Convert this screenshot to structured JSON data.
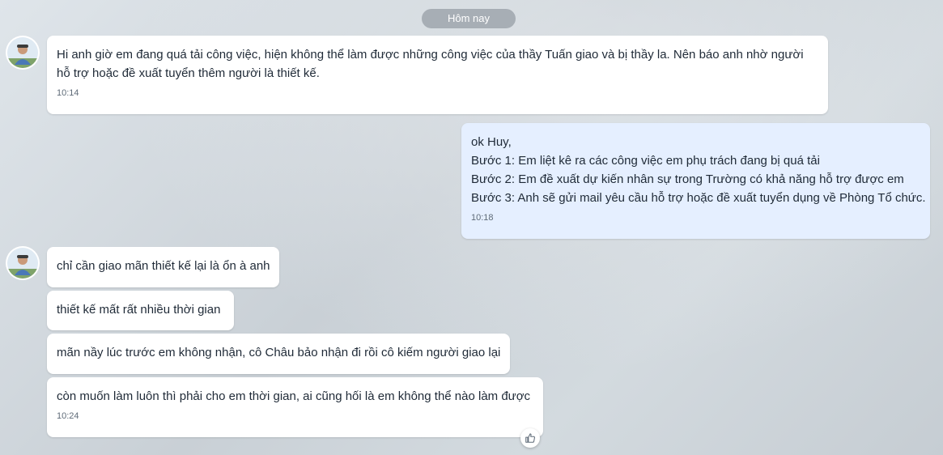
{
  "date_divider": "Hôm nay",
  "messages": [
    {
      "text": "Hi anh giờ em đang quá tải công việc, hiện không thể làm được những công việc của thầy Tuấn giao và bị thầy la. Nên báo anh nhờ người hỗ trợ hoặc đề xuất tuyển thêm người là thiết kế.",
      "time": "10:14"
    },
    {
      "lines": [
        "ok Huy,",
        "Bước 1: Em liệt kê ra các công việc em phụ trách đang bị quá tải",
        "Bước 2: Em đề xuất dự kiến nhân sự trong Trường có khả năng hỗ trợ được em",
        "Bước 3: Anh sẽ gửi mail yêu cầu hỗ trợ hoặc đề xuất tuyển dụng về Phòng Tổ chức."
      ],
      "time": "10:18"
    },
    {
      "text": "chỉ cần giao mãn thiết kế lại là ổn à anh"
    },
    {
      "text": "thiết kế mất rất nhiều thời gian"
    },
    {
      "text": "mãn nầy lúc trước em không nhận, cô Châu bảo nhận đi rồi cô kiếm người giao lại"
    },
    {
      "text": "còn muốn làm luôn thì phải cho em thời gian, ai cũng hối là em không thể nào làm được",
      "time": "10:24"
    }
  ],
  "icons": {
    "avatar": "user-avatar-icon",
    "reaction": "thumbs-up-icon"
  }
}
